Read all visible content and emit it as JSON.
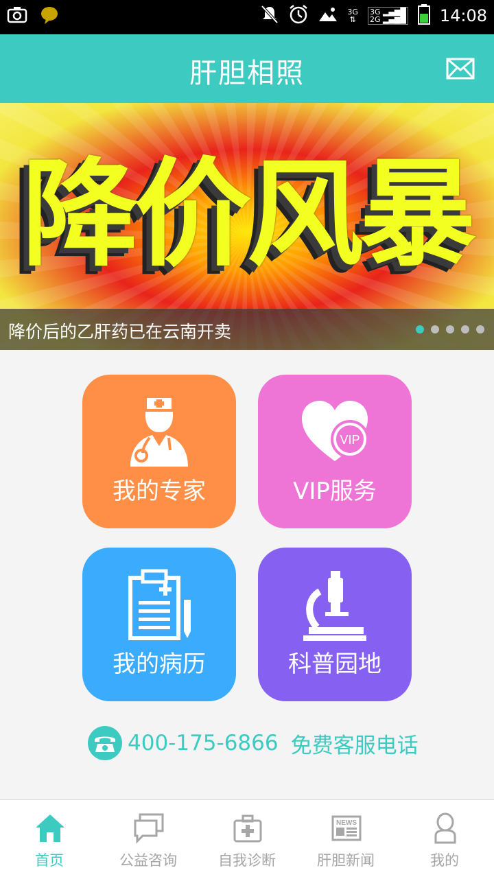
{
  "status_bar": {
    "time": "14:08",
    "network_top": "3G",
    "network_bottom": "2G",
    "network_indicator": "3G"
  },
  "header": {
    "title": "肝胆相照"
  },
  "banner": {
    "headline": "降价风暴",
    "caption": "降价后的乙肝药已在云南开卖",
    "slide_count": 5,
    "active_slide": 1
  },
  "tiles": [
    {
      "label": "我的专家",
      "icon": "doctor-icon",
      "color": "#ff8f47"
    },
    {
      "label": "VIP服务",
      "icon": "vip-heart-icon",
      "color": "#ee74d6"
    },
    {
      "label": "我的病历",
      "icon": "medical-record-icon",
      "color": "#3aabfd"
    },
    {
      "label": "科普园地",
      "icon": "microscope-icon",
      "color": "#8560f1"
    }
  ],
  "vip_badge": "VIP",
  "hotline": {
    "number": "400-175-6866",
    "label": "免费客服电话"
  },
  "bottom_nav": [
    {
      "label": "首页",
      "icon": "home-icon",
      "active": true
    },
    {
      "label": "公益咨询",
      "icon": "chat-icon",
      "active": false
    },
    {
      "label": "自我诊断",
      "icon": "medkit-icon",
      "active": false
    },
    {
      "label": "肝胆新闻",
      "icon": "news-icon",
      "active": false
    },
    {
      "label": "我的",
      "icon": "person-icon",
      "active": false
    }
  ],
  "news_icon_text": "NEWS",
  "colors": {
    "accent": "#3dcac1",
    "inactive": "#a6a6a6"
  }
}
